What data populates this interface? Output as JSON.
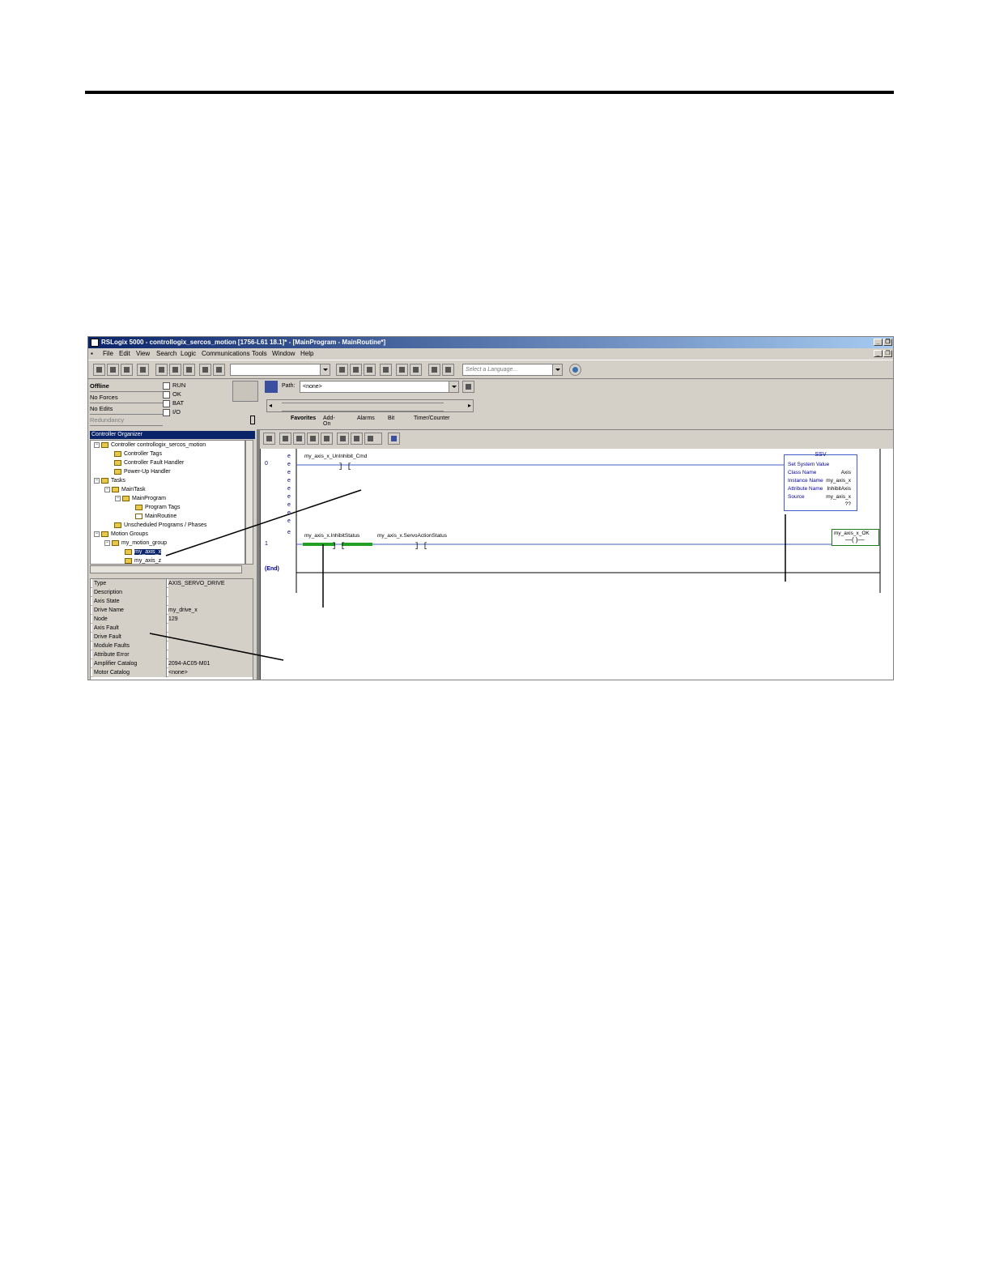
{
  "window": {
    "title": "RSLogix 5000 - controllogix_sercos_motion [1756-L61 18.1]* - [MainProgram - MainRoutine*]",
    "menu": [
      "File",
      "Edit",
      "View",
      "Search",
      "Logic",
      "Communications",
      "Tools",
      "Window",
      "Help"
    ]
  },
  "toolbar": {
    "language_placeholder": "Select a Language..."
  },
  "status": {
    "mode": "Offline",
    "forces": "No Forces",
    "edits": "No Edits",
    "redundancy": "Redundancy",
    "indicators": [
      "RUN",
      "OK",
      "BAT",
      "I/O"
    ]
  },
  "path": {
    "label": "Path:",
    "value": "<none>"
  },
  "instr_tabs": [
    "Favorites",
    "Add-On",
    "Alarms",
    "Bit",
    "Timer/Counter"
  ],
  "organizer": {
    "title": "Controller Organizer",
    "tree": [
      "Controller controllogix_sercos_motion",
      "Controller Tags",
      "Controller Fault Handler",
      "Power-Up Handler",
      "Tasks",
      "MainTask",
      "MainProgram",
      "Program Tags",
      "MainRoutine",
      "Unscheduled Programs / Phases",
      "Motion Groups",
      "my_motion_group",
      "my_axis_x",
      "my_axis_z"
    ],
    "properties": [
      {
        "k": "Type",
        "v": "AXIS_SERVO_DRIVE"
      },
      {
        "k": "Description",
        "v": ""
      },
      {
        "k": "Axis State",
        "v": ""
      },
      {
        "k": "Drive Name",
        "v": "my_drive_x"
      },
      {
        "k": "Node",
        "v": "129"
      },
      {
        "k": "Axis Fault",
        "v": ""
      },
      {
        "k": "Drive Fault",
        "v": ""
      },
      {
        "k": "Module Faults",
        "v": ""
      },
      {
        "k": "Attribute Error",
        "v": ""
      },
      {
        "k": "Amplifier Catalog",
        "v": "2094-AC05-M01"
      },
      {
        "k": "Motor Catalog",
        "v": "<none>"
      }
    ]
  },
  "ladder": {
    "rung0_num": "0",
    "rung1_num": "1",
    "e_marks": [
      "e",
      "e",
      "e",
      "e",
      "e",
      "e",
      "e",
      "e",
      "e",
      "e"
    ],
    "rung0_contact": "my_axis_x_UnInhibit_Cmd",
    "rung1_contact1": "my_axis_x.InhibitStatus",
    "rung1_contact2": "my_axis_x.ServoActionStatus",
    "ssv": {
      "title": "SSV",
      "header": "Set System Value",
      "rows": [
        {
          "k": "Class Name",
          "v": "Axis"
        },
        {
          "k": "Instance Name",
          "v": "my_axis_x"
        },
        {
          "k": "Attribute Name",
          "v": "InhibitAxis"
        },
        {
          "k": "Source",
          "v": "my_axis_x"
        }
      ],
      "source_value": "??"
    },
    "output_coil": "my_axis_x_OK",
    "end": "(End)"
  }
}
